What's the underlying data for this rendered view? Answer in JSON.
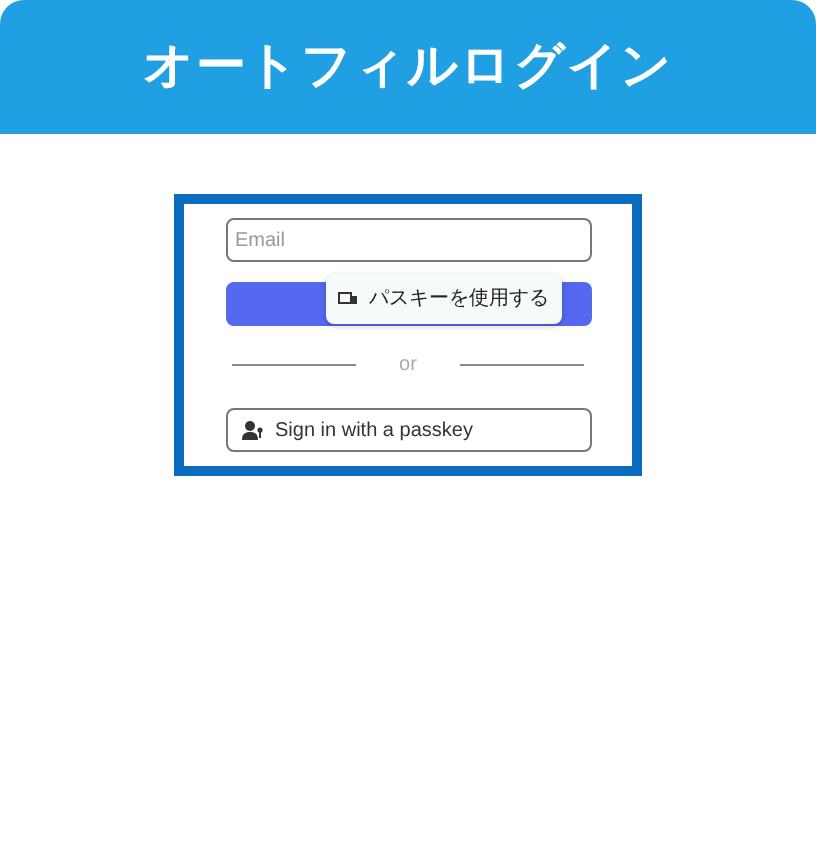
{
  "header": {
    "title": "オートフィルログイン"
  },
  "email_field": {
    "placeholder": "Email"
  },
  "autofill_popup": {
    "label": "パスキーを使用する"
  },
  "divider": {
    "label": "or"
  },
  "passkey_button": {
    "label": "Sign in with a passkey"
  }
}
